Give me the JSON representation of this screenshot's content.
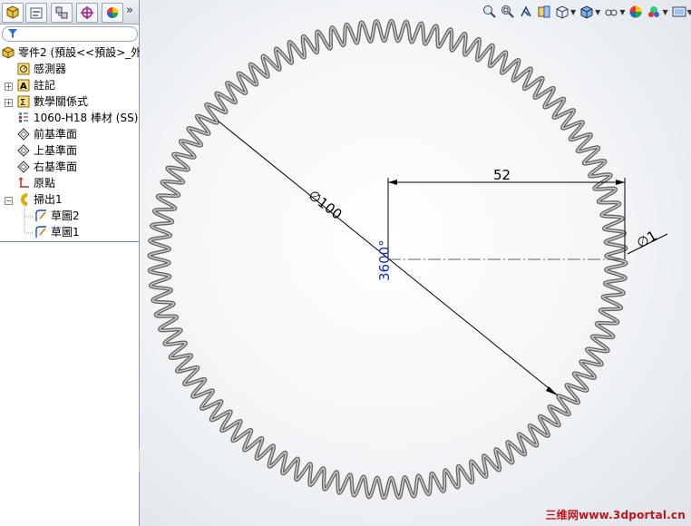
{
  "feature_tree": {
    "root": "零件2  (預設<<預設>_外",
    "items": [
      {
        "label": "感測器",
        "icon": "sensor-icon"
      },
      {
        "label": "註記",
        "icon": "annotation-icon"
      },
      {
        "label": "數學關係式",
        "icon": "equation-icon"
      },
      {
        "label": "1060-H18 棒材 (SS)",
        "icon": "material-icon"
      },
      {
        "label": "前基準面",
        "icon": "plane-icon"
      },
      {
        "label": "上基準面",
        "icon": "plane-icon"
      },
      {
        "label": "右基準面",
        "icon": "plane-icon"
      },
      {
        "label": "原點",
        "icon": "origin-icon"
      },
      {
        "label": "掃出1",
        "icon": "sweep-icon"
      },
      {
        "label": "草圖2",
        "icon": "sketch-icon"
      },
      {
        "label": "草圖1",
        "icon": "sketch-icon"
      }
    ]
  },
  "dimensions": {
    "diameter_large": "100",
    "horizontal": "52",
    "diameter_small": "1",
    "angle": "3600°"
  },
  "watermark": "三维网www.3dportal.cn",
  "colors": {
    "angle_dim": "#1f2fa8",
    "dimension": "#000000"
  }
}
